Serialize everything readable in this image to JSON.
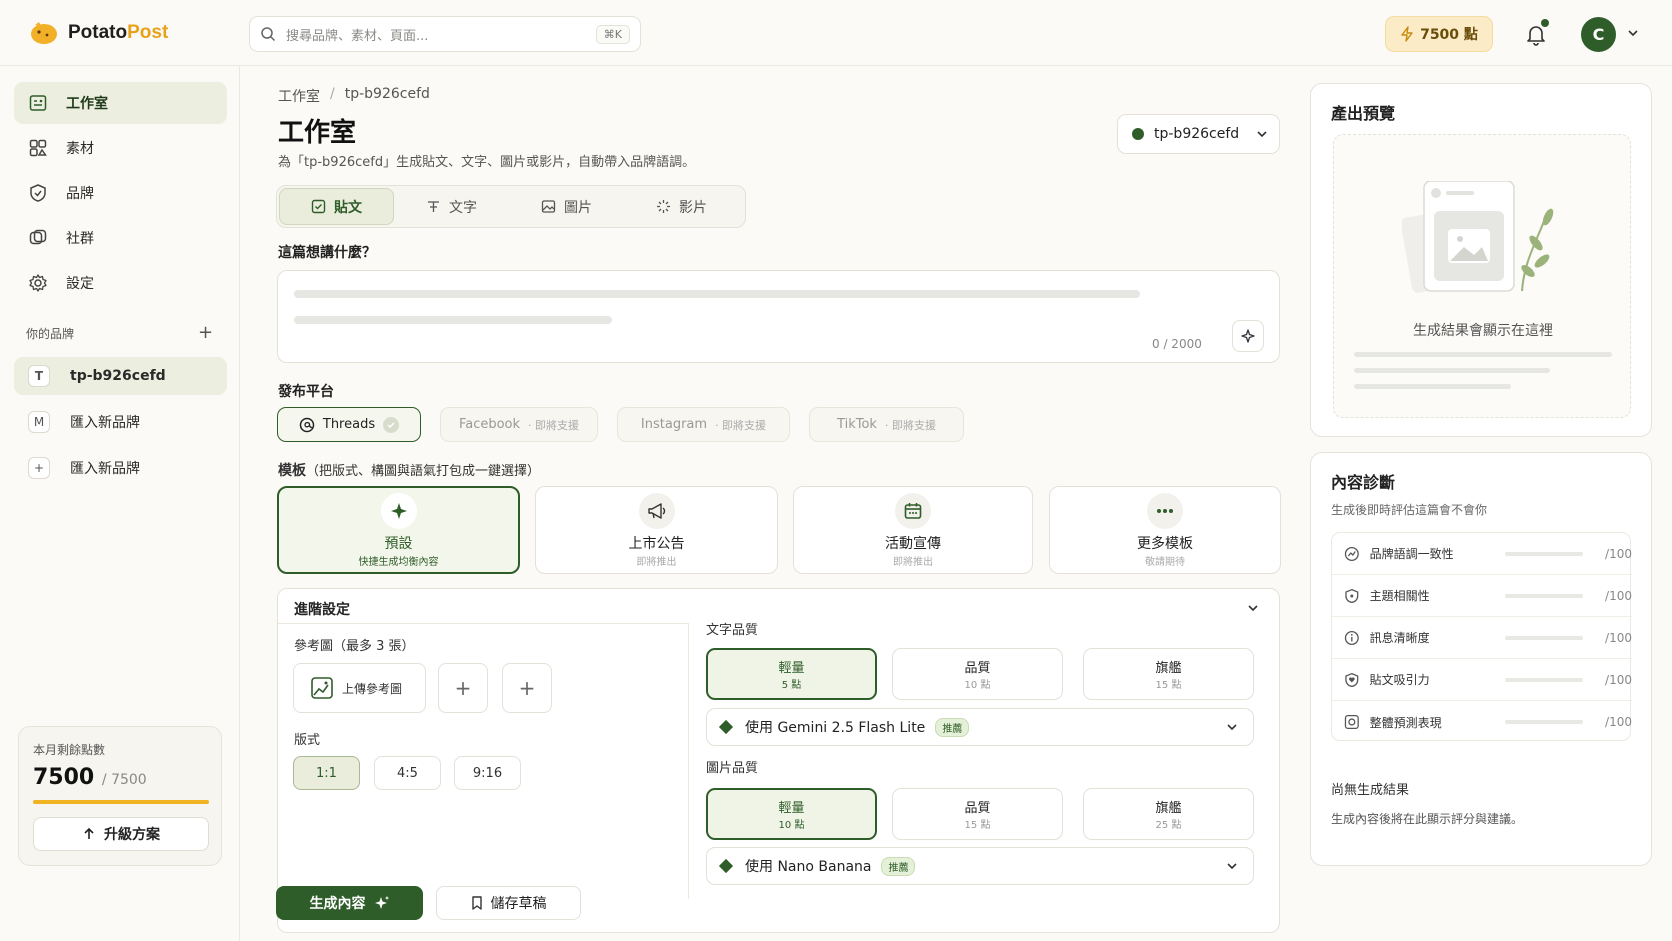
{
  "header": {
    "logo_prefix": "Potato",
    "logo_suffix": "Post",
    "search_placeholder": "搜尋品牌、素材、頁面...",
    "search_shortcut": "⌘K",
    "points": "7500 點",
    "avatar_initial": "C"
  },
  "sidebar": {
    "nav": [
      {
        "label": "工作室",
        "icon": "studio-icon"
      },
      {
        "label": "素材",
        "icon": "assets-icon"
      },
      {
        "label": "品牌",
        "icon": "brand-shield-icon"
      },
      {
        "label": "社群",
        "icon": "community-icon"
      },
      {
        "label": "設定",
        "icon": "gear-icon"
      }
    ],
    "brands_label": "你的品牌",
    "brands": [
      {
        "badge": "T",
        "label": "tp-b926cefd"
      },
      {
        "badge": "M",
        "label": "匯入新品牌"
      },
      {
        "badge": "+",
        "label": "匯入新品牌"
      }
    ],
    "credits": {
      "label": "本月剩餘點數",
      "value": "7500",
      "max": "/ 7500",
      "fraction": 1.0,
      "upgrade_label": "升級方案"
    }
  },
  "main": {
    "breadcrumb_root": "工作室",
    "breadcrumb_sep": "/",
    "breadcrumb_current": "tp-b926cefd",
    "title": "工作室",
    "subtitle": "為「tp-b926cefd」生成貼文、文字、圖片或影片，自動帶入品牌語調。",
    "brand_select": "tp-b926cefd",
    "tabs": [
      {
        "label": "貼文"
      },
      {
        "label": "文字"
      },
      {
        "label": "圖片"
      },
      {
        "label": "影片"
      }
    ],
    "prompt_label": "這篇想講什麼？",
    "char_counter": "0 / 2000",
    "platform_label": "發布平台",
    "platforms": [
      {
        "label": "Threads",
        "soon": ""
      },
      {
        "label": "Facebook",
        "soon": "· 即將支援"
      },
      {
        "label": "Instagram",
        "soon": "· 即將支援"
      },
      {
        "label": "TikTok",
        "soon": "· 即將支援"
      }
    ],
    "template_label": "模板",
    "template_hint": "（把版式、構圖與語氣打包成一鍵選擇）",
    "templates": [
      {
        "name": "預設",
        "desc": "快捷生成均衡內容"
      },
      {
        "name": "上市公告",
        "desc": "即將推出"
      },
      {
        "name": "活動宣傳",
        "desc": "即將推出"
      },
      {
        "name": "更多模板",
        "desc": "敬請期待"
      }
    ],
    "advanced": {
      "title": "進階設定",
      "ref_label": "參考圖（最多 3 張）",
      "ref_upload": "上傳參考圖",
      "ratio_label": "版式",
      "ratios": [
        "1:1",
        "4:5",
        "9:16"
      ],
      "text_quality_label": "文字品質",
      "text_quality": [
        {
          "name": "輕量",
          "cost": "5 點"
        },
        {
          "name": "品質",
          "cost": "10 點"
        },
        {
          "name": "旗艦",
          "cost": "15 點"
        }
      ],
      "text_model": "使用 Gemini 2.5 Flash Lite",
      "image_quality_label": "圖片品質",
      "image_quality": [
        {
          "name": "輕量",
          "cost": "10 點"
        },
        {
          "name": "品質",
          "cost": "15 點"
        },
        {
          "name": "旗艦",
          "cost": "25 點"
        }
      ],
      "image_model": "使用 Nano Banana",
      "recommended": "推薦"
    },
    "generate_label": "生成內容",
    "draft_label": "儲存草稿"
  },
  "right": {
    "preview_title": "產出預覽",
    "preview_placeholder": "生成結果會顯示在這裡",
    "diag_title": "內容診斷",
    "diag_sub": "生成後即時評估這篇會不會你",
    "diag_items": [
      {
        "label": "品牌語調一致性",
        "score": "/100",
        "icon": "tone-icon"
      },
      {
        "label": "主題相關性",
        "score": "/100",
        "icon": "topic-icon"
      },
      {
        "label": "訊息清晰度",
        "score": "/100",
        "icon": "info-icon"
      },
      {
        "label": "貼文吸引力",
        "score": "/100",
        "icon": "appeal-icon"
      },
      {
        "label": "整體預測表現",
        "score": "/100",
        "icon": "forecast-icon"
      }
    ],
    "no_result_title": "尚無生成結果",
    "no_result_sub": "生成內容後將在此顯示評分與建議。"
  },
  "colors": {
    "accent": "#2f5d2a",
    "points_bg": "#fbecc7",
    "credits_bar": "#f0b323"
  }
}
